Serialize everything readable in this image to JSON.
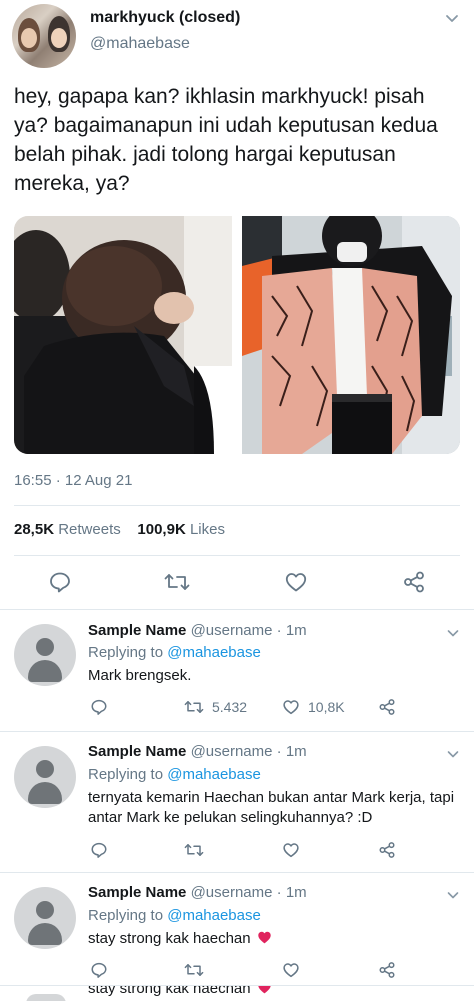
{
  "tweet": {
    "display_name": "markhyuck (closed)",
    "handle": "@mahaebase",
    "text": "hey, gapapa kan? ikhlasin markhyuck! pisah ya? bagaimanapun ini udah keputusan kedua belah pihak. jadi tolong hargai keputusan mereka, ya?",
    "timestamp": "16:55 · 12 Aug 21",
    "retweets_count": "28,5K",
    "retweets_label": "Retweets",
    "likes_count": "100,9K",
    "likes_label": "Likes"
  },
  "replies": [
    {
      "name": "Sample Name",
      "username": "@username · 1m",
      "replying_prefix": "Replying to",
      "replying_to": "@mahaebase",
      "text": "Mark brengsek.",
      "retweets": "5.432",
      "likes": "10,8K"
    },
    {
      "name": "Sample Name",
      "username": "@username · 1m",
      "replying_prefix": "Replying to",
      "replying_to": "@mahaebase",
      "text": "ternyata kemarin Haechan bukan antar Mark kerja, tapi antar Mark ke pelukan selingkuhannya? :D",
      "retweets": "",
      "likes": ""
    },
    {
      "name": "Sample Name",
      "username": "@username · 1m",
      "replying_prefix": "Replying to",
      "replying_to": "@mahaebase",
      "text": "stay strong kak haechan",
      "retweets": "",
      "likes": ""
    }
  ],
  "cutoff_text": "stay strong kak haechan",
  "colors": {
    "text": "#14171a",
    "secondary": "#657786",
    "link": "#1b95e0",
    "divider": "#e1e8ed",
    "icon": "#657786",
    "heart_red": "#e0245e"
  },
  "icons": [
    "chevron-down-icon",
    "reply-icon",
    "retweet-icon",
    "like-icon",
    "share-icon",
    "red-heart-emoji"
  ]
}
